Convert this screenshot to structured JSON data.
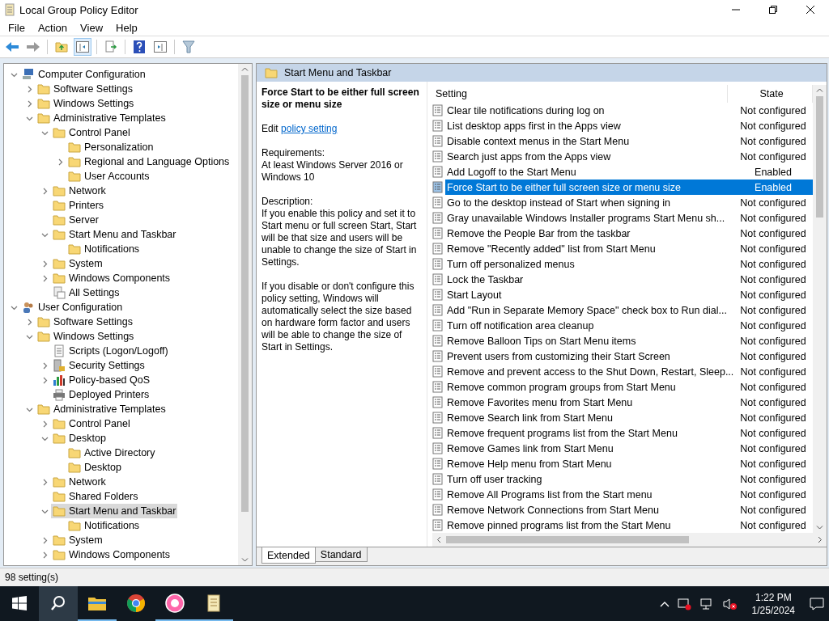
{
  "window": {
    "title": "Local Group Policy Editor"
  },
  "menu": [
    "File",
    "Action",
    "View",
    "Help"
  ],
  "tree": [
    {
      "label": "Computer Configuration",
      "kind": "computer",
      "expanded": true,
      "selected": false,
      "children": [
        {
          "label": "Software Settings",
          "kind": "folder",
          "expanded": false,
          "selected": false
        },
        {
          "label": "Windows Settings",
          "kind": "folder",
          "expanded": false,
          "selected": false
        },
        {
          "label": "Administrative Templates",
          "kind": "folder",
          "expanded": true,
          "selected": false,
          "children": [
            {
              "label": "Control Panel",
              "kind": "folder",
              "expanded": true,
              "selected": false,
              "children": [
                {
                  "label": "Personalization",
                  "kind": "folder",
                  "selected": false
                },
                {
                  "label": "Regional and Language Options",
                  "kind": "folder",
                  "expanded": false,
                  "selected": false
                },
                {
                  "label": "User Accounts",
                  "kind": "folder",
                  "selected": false
                }
              ]
            },
            {
              "label": "Network",
              "kind": "folder",
              "expanded": false,
              "selected": false
            },
            {
              "label": "Printers",
              "kind": "folder",
              "selected": false
            },
            {
              "label": "Server",
              "kind": "folder",
              "selected": false
            },
            {
              "label": "Start Menu and Taskbar",
              "kind": "folder",
              "expanded": true,
              "selected": false,
              "children": [
                {
                  "label": "Notifications",
                  "kind": "folder",
                  "selected": false
                }
              ]
            },
            {
              "label": "System",
              "kind": "folder",
              "expanded": false,
              "selected": false
            },
            {
              "label": "Windows Components",
              "kind": "folder",
              "expanded": false,
              "selected": false
            },
            {
              "label": "All Settings",
              "kind": "settings",
              "selected": false
            }
          ]
        }
      ]
    },
    {
      "label": "User Configuration",
      "kind": "user",
      "expanded": true,
      "selected": false,
      "children": [
        {
          "label": "Software Settings",
          "kind": "folder",
          "expanded": false,
          "selected": false
        },
        {
          "label": "Windows Settings",
          "kind": "folder",
          "expanded": true,
          "selected": false,
          "children": [
            {
              "label": "Scripts (Logon/Logoff)",
              "kind": "script",
              "selected": false
            },
            {
              "label": "Security Settings",
              "kind": "security",
              "expanded": false,
              "selected": false
            },
            {
              "label": "Policy-based QoS",
              "kind": "chart",
              "expanded": false,
              "selected": false
            },
            {
              "label": "Deployed Printers",
              "kind": "printer",
              "selected": false
            }
          ]
        },
        {
          "label": "Administrative Templates",
          "kind": "folder",
          "expanded": true,
          "selected": false,
          "children": [
            {
              "label": "Control Panel",
              "kind": "folder",
              "expanded": false,
              "selected": false
            },
            {
              "label": "Desktop",
              "kind": "folder",
              "expanded": true,
              "selected": false,
              "children": [
                {
                  "label": "Active Directory",
                  "kind": "folder",
                  "selected": false
                },
                {
                  "label": "Desktop",
                  "kind": "folder",
                  "selected": false
                }
              ]
            },
            {
              "label": "Network",
              "kind": "folder",
              "expanded": false,
              "selected": false
            },
            {
              "label": "Shared Folders",
              "kind": "folder",
              "selected": false
            },
            {
              "label": "Start Menu and Taskbar",
              "kind": "folder",
              "expanded": true,
              "selected": true,
              "children": [
                {
                  "label": "Notifications",
                  "kind": "folder",
                  "selected": false
                }
              ]
            },
            {
              "label": "System",
              "kind": "folder",
              "expanded": false,
              "selected": false
            },
            {
              "label": "Windows Components",
              "kind": "folder",
              "expanded": false,
              "selected": false
            }
          ]
        }
      ]
    }
  ],
  "pane_header": "Start Menu and Taskbar",
  "details": {
    "title": "Force Start to be either full screen size or menu size",
    "edit_prefix": "Edit",
    "edit_link": "policy setting",
    "requirements_label": "Requirements:",
    "requirements": "At least Windows Server 2016 or Windows 10",
    "description_label": "Description:",
    "paragraphs": [
      "If you enable this policy and set it to Start menu or full screen Start, Start will be that size and users will be unable to change the size of Start in Settings.",
      "If you disable or don't configure this policy setting, Windows will automatically select the size based on hardware form factor and users will be able to change the size of Start in Settings."
    ]
  },
  "table": {
    "columns": [
      "Setting",
      "State"
    ],
    "rows": [
      {
        "name": "Clear tile notifications during log on",
        "state": "Not configured",
        "selected": false
      },
      {
        "name": "List desktop apps first in the Apps view",
        "state": "Not configured",
        "selected": false
      },
      {
        "name": "Disable context menus in the Start Menu",
        "state": "Not configured",
        "selected": false
      },
      {
        "name": "Search just apps from the Apps view",
        "state": "Not configured",
        "selected": false
      },
      {
        "name": "Add Logoff to the Start Menu",
        "state": "Enabled",
        "selected": false
      },
      {
        "name": "Force Start to be either full screen size or menu size",
        "state": "Enabled",
        "selected": true
      },
      {
        "name": "Go to the desktop instead of Start when signing in",
        "state": "Not configured",
        "selected": false
      },
      {
        "name": "Gray unavailable Windows Installer programs Start Menu sh...",
        "state": "Not configured",
        "selected": false
      },
      {
        "name": "Remove the People Bar from the taskbar",
        "state": "Not configured",
        "selected": false
      },
      {
        "name": "Remove \"Recently added\" list from Start Menu",
        "state": "Not configured",
        "selected": false
      },
      {
        "name": "Turn off personalized menus",
        "state": "Not configured",
        "selected": false
      },
      {
        "name": "Lock the Taskbar",
        "state": "Not configured",
        "selected": false
      },
      {
        "name": "Start Layout",
        "state": "Not configured",
        "selected": false
      },
      {
        "name": "Add \"Run in Separate Memory Space\" check box to Run dial...",
        "state": "Not configured",
        "selected": false
      },
      {
        "name": "Turn off notification area cleanup",
        "state": "Not configured",
        "selected": false
      },
      {
        "name": "Remove Balloon Tips on Start Menu items",
        "state": "Not configured",
        "selected": false
      },
      {
        "name": "Prevent users from customizing their Start Screen",
        "state": "Not configured",
        "selected": false
      },
      {
        "name": "Remove and prevent access to the Shut Down, Restart, Sleep...",
        "state": "Not configured",
        "selected": false
      },
      {
        "name": "Remove common program groups from Start Menu",
        "state": "Not configured",
        "selected": false
      },
      {
        "name": "Remove Favorites menu from Start Menu",
        "state": "Not configured",
        "selected": false
      },
      {
        "name": "Remove Search link from Start Menu",
        "state": "Not configured",
        "selected": false
      },
      {
        "name": "Remove frequent programs list from the Start Menu",
        "state": "Not configured",
        "selected": false
      },
      {
        "name": "Remove Games link from Start Menu",
        "state": "Not configured",
        "selected": false
      },
      {
        "name": "Remove Help menu from Start Menu",
        "state": "Not configured",
        "selected": false
      },
      {
        "name": "Turn off user tracking",
        "state": "Not configured",
        "selected": false
      },
      {
        "name": "Remove All Programs list from the Start menu",
        "state": "Not configured",
        "selected": false
      },
      {
        "name": "Remove Network Connections from Start Menu",
        "state": "Not configured",
        "selected": false
      },
      {
        "name": "Remove pinned programs list from the Start Menu",
        "state": "Not configured",
        "selected": false
      }
    ]
  },
  "view_tabs": [
    {
      "label": "Extended",
      "selected": true
    },
    {
      "label": "Standard",
      "selected": false
    }
  ],
  "status_bar": "98 setting(s)",
  "taskbar": {
    "apps": [
      {
        "kind": "search",
        "selected": true,
        "running": false
      },
      {
        "kind": "explorer",
        "selected": false,
        "running": true
      },
      {
        "kind": "chrome",
        "selected": false,
        "running": false
      },
      {
        "kind": "osu",
        "selected": false,
        "running": true
      },
      {
        "kind": "editor",
        "selected": false,
        "running": true
      }
    ],
    "time": "1:22 PM",
    "date": "1/25/2024"
  }
}
